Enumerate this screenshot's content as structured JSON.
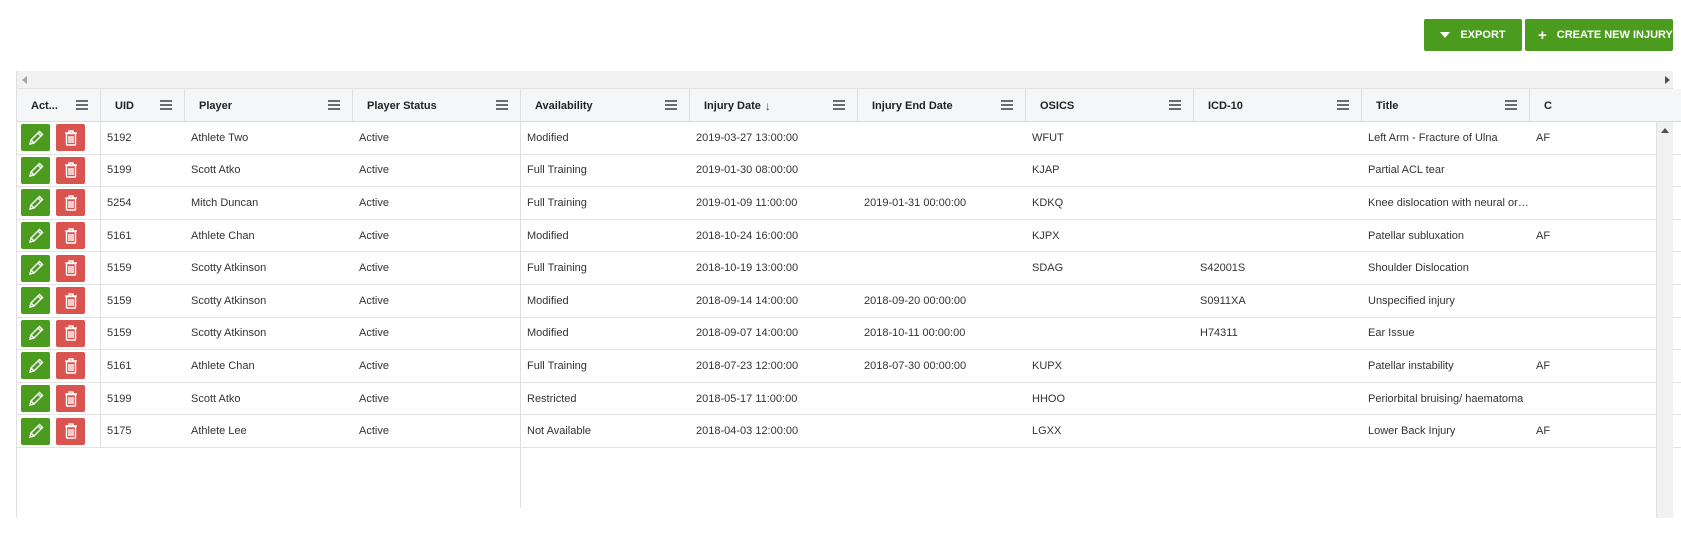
{
  "toolbar": {
    "export_label": "EXPORT",
    "create_label": "CREATE NEW INJURY"
  },
  "columns": [
    {
      "key": "actions",
      "label": "Act..."
    },
    {
      "key": "uid",
      "label": "UID"
    },
    {
      "key": "player",
      "label": "Player"
    },
    {
      "key": "player_status",
      "label": "Player Status"
    },
    {
      "key": "availability",
      "label": "Availability"
    },
    {
      "key": "injury_date",
      "label": "Injury Date",
      "sort": "↓"
    },
    {
      "key": "injury_end_date",
      "label": "Injury End Date"
    },
    {
      "key": "osics",
      "label": "OSICS"
    },
    {
      "key": "icd10",
      "label": "ICD-10"
    },
    {
      "key": "title",
      "label": "Title"
    },
    {
      "key": "extra",
      "label": "C"
    }
  ],
  "rows": [
    {
      "uid": "5192",
      "player": "Athlete Two",
      "player_status": "Active",
      "availability": "Modified",
      "injury_date": "2019-03-27 13:00:00",
      "injury_end_date": "",
      "osics": "WFUT",
      "icd10": "",
      "title": "Left Arm - Fracture of Ulna",
      "extra": "AF"
    },
    {
      "uid": "5199",
      "player": "Scott Atko",
      "player_status": "Active",
      "availability": "Full Training",
      "injury_date": "2019-01-30 08:00:00",
      "injury_end_date": "",
      "osics": "KJAP",
      "icd10": "",
      "title": "Partial ACL tear",
      "extra": ""
    },
    {
      "uid": "5254",
      "player": "Mitch Duncan",
      "player_status": "Active",
      "availability": "Full Training",
      "injury_date": "2019-01-09 11:00:00",
      "injury_end_date": "2019-01-31 00:00:00",
      "osics": "KDKQ",
      "icd10": "",
      "title": "Knee dislocation with neural or ...",
      "extra": ""
    },
    {
      "uid": "5161",
      "player": "Athlete Chan",
      "player_status": "Active",
      "availability": "Modified",
      "injury_date": "2018-10-24 16:00:00",
      "injury_end_date": "",
      "osics": "KJPX",
      "icd10": "",
      "title": "Patellar subluxation",
      "extra": "AF"
    },
    {
      "uid": "5159",
      "player": "Scotty Atkinson",
      "player_status": "Active",
      "availability": "Full Training",
      "injury_date": "2018-10-19 13:00:00",
      "injury_end_date": "",
      "osics": "SDAG",
      "icd10": "S42001S",
      "title": "Shoulder Dislocation",
      "extra": ""
    },
    {
      "uid": "5159",
      "player": "Scotty Atkinson",
      "player_status": "Active",
      "availability": "Modified",
      "injury_date": "2018-09-14 14:00:00",
      "injury_end_date": "2018-09-20 00:00:00",
      "osics": "",
      "icd10": "S0911XA",
      "title": "Unspecified injury",
      "extra": ""
    },
    {
      "uid": "5159",
      "player": "Scotty Atkinson",
      "player_status": "Active",
      "availability": "Modified",
      "injury_date": "2018-09-07 14:00:00",
      "injury_end_date": "2018-10-11 00:00:00",
      "osics": "",
      "icd10": "H74311",
      "title": "Ear Issue",
      "extra": ""
    },
    {
      "uid": "5161",
      "player": "Athlete Chan",
      "player_status": "Active",
      "availability": "Full Training",
      "injury_date": "2018-07-23 12:00:00",
      "injury_end_date": "2018-07-30 00:00:00",
      "osics": "KUPX",
      "icd10": "",
      "title": "Patellar instability",
      "extra": "AF"
    },
    {
      "uid": "5199",
      "player": "Scott Atko",
      "player_status": "Active",
      "availability": "Restricted",
      "injury_date": "2018-05-17 11:00:00",
      "injury_end_date": "",
      "osics": "HHOO",
      "icd10": "",
      "title": "Periorbital bruising/ haematoma",
      "extra": ""
    },
    {
      "uid": "5175",
      "player": "Athlete Lee",
      "player_status": "Active",
      "availability": "Not Available",
      "injury_date": "2018-04-03 12:00:00",
      "injury_end_date": "",
      "osics": "LGXX",
      "icd10": "",
      "title": "Lower Back Injury",
      "extra": "AF"
    }
  ],
  "icons": {
    "edit": "pencil-icon",
    "delete": "trash-icon",
    "column_menu": "hamburger-menu-icon",
    "export_caret": "caret-down-icon",
    "create_plus": "plus-icon"
  },
  "colors": {
    "primary_green": "#4b9c1e",
    "delete_red": "#d9534f"
  }
}
